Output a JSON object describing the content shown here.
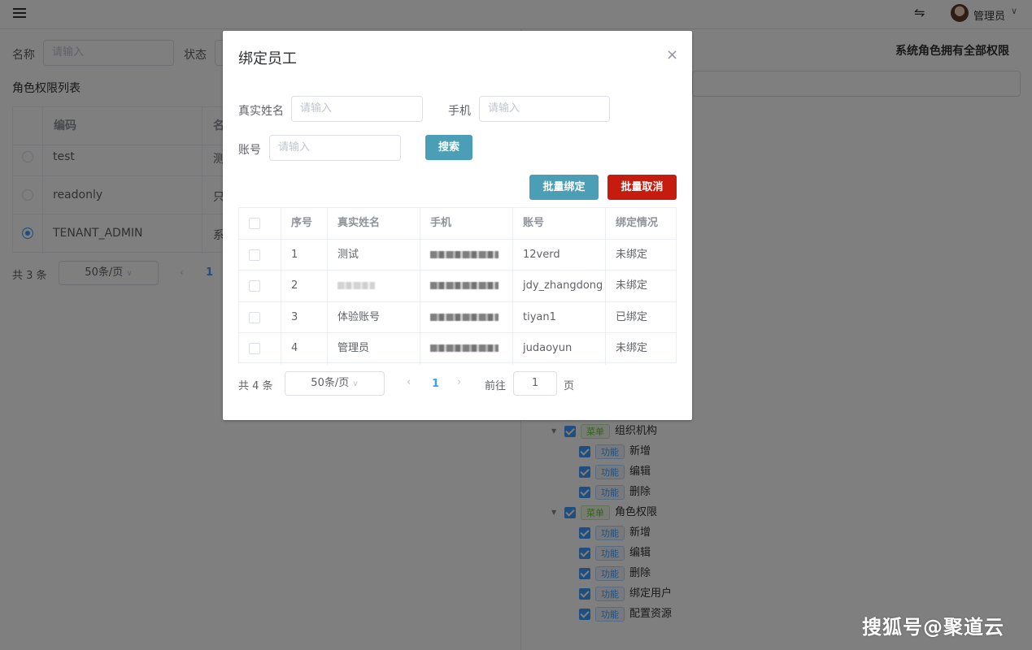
{
  "header": {
    "username": "管理员"
  },
  "filters": {
    "name_label": "名称",
    "name_placeholder": "请输入",
    "status_label": "状态"
  },
  "left": {
    "section_title": "角色权限列表",
    "columns": [
      "编码",
      "名"
    ],
    "rows": [
      {
        "code": "test",
        "name": "测",
        "selected": false
      },
      {
        "code": "readonly",
        "name": "只",
        "selected": false
      },
      {
        "code": "TENANT_ADMIN",
        "name": "系",
        "selected": true
      }
    ],
    "pager": {
      "total": "共 3 条",
      "page_size": "50条/页",
      "page": "1"
    }
  },
  "right": {
    "note": "系统角色拥有全部权限",
    "tree": [
      {
        "level": 0,
        "tag": "菜单",
        "tagtype": "menu",
        "label": "组织机构"
      },
      {
        "level": 1,
        "tag": "功能",
        "tagtype": "func",
        "label": "新增"
      },
      {
        "level": 1,
        "tag": "功能",
        "tagtype": "func",
        "label": "编辑"
      },
      {
        "level": 1,
        "tag": "功能",
        "tagtype": "func",
        "label": "删除"
      },
      {
        "level": 0,
        "tag": "菜单",
        "tagtype": "menu",
        "label": "角色权限"
      },
      {
        "level": 1,
        "tag": "功能",
        "tagtype": "func",
        "label": "新增"
      },
      {
        "level": 1,
        "tag": "功能",
        "tagtype": "func",
        "label": "编辑"
      },
      {
        "level": 1,
        "tag": "功能",
        "tagtype": "func",
        "label": "删除"
      },
      {
        "level": 1,
        "tag": "功能",
        "tagtype": "func",
        "label": "绑定用户"
      },
      {
        "level": 1,
        "tag": "功能",
        "tagtype": "func",
        "label": "配置资源"
      }
    ]
  },
  "dialog": {
    "title": "绑定员工",
    "realname_label": "真实姓名",
    "realname_placeholder": "请输入",
    "phone_label": "手机",
    "phone_placeholder": "请输入",
    "account_label": "账号",
    "account_placeholder": "请输入",
    "search_button": "搜索",
    "bind_button": "批量绑定",
    "unbind_button": "批量取消",
    "columns": [
      "序号",
      "真实姓名",
      "手机",
      "账号",
      "绑定情况"
    ],
    "rows": [
      {
        "no": "1",
        "name": "测试",
        "account": "12verd",
        "status": "未绑定"
      },
      {
        "no": "2",
        "name": "",
        "account": "jdy_zhangdong",
        "status": "未绑定"
      },
      {
        "no": "3",
        "name": "体验账号",
        "account": "tiyan1",
        "status": "已绑定"
      },
      {
        "no": "4",
        "name": "管理员",
        "account": "judaoyun",
        "status": "未绑定"
      }
    ],
    "pager": {
      "total": "共 4 条",
      "page_size": "50条/页",
      "page": "1",
      "goto_label": "前往",
      "goto_value": "1",
      "page_suffix": "页"
    }
  },
  "watermark": "搜狐号@聚道云",
  "colors": {
    "primary": "#409eff",
    "search_btn": "#4a9eb5",
    "danger_btn": "#c51c0f"
  }
}
